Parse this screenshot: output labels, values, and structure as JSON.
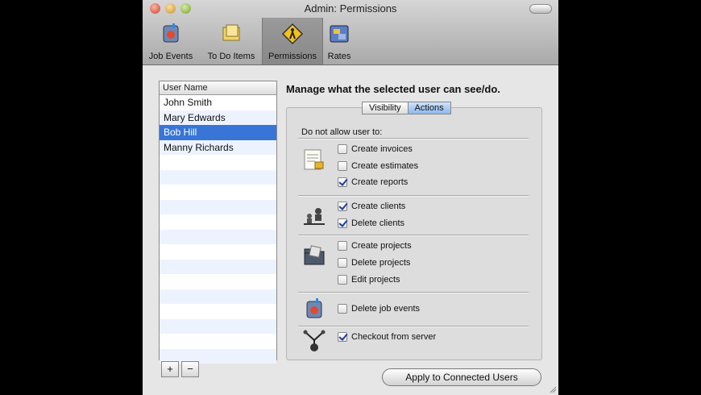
{
  "window": {
    "title": "Admin: Permissions"
  },
  "toolbar": {
    "items": [
      {
        "label": "Job Events",
        "icon": "job-events-icon"
      },
      {
        "label": "To Do Items",
        "icon": "todo-icon"
      },
      {
        "label": "Permissions",
        "icon": "permissions-icon",
        "selected": true
      },
      {
        "label": "Rates",
        "icon": "rates-icon"
      }
    ]
  },
  "users": {
    "header": "User Name",
    "rows": [
      "John Smith",
      "Mary Edwards",
      "Bob Hill",
      "Manny Richards"
    ],
    "selected_index": 2,
    "add_label": "+",
    "remove_label": "−"
  },
  "panel": {
    "heading": "Manage what the selected user can see/do.",
    "tabs": [
      {
        "label": "Visibility"
      },
      {
        "label": "Actions",
        "active": true
      }
    ],
    "group_title": "Do not allow user to:",
    "groups": [
      {
        "icon": "invoice-icon",
        "items": [
          {
            "label": "Create invoices",
            "checked": false
          },
          {
            "label": "Create estimates",
            "checked": false
          },
          {
            "label": "Create reports",
            "checked": true
          }
        ]
      },
      {
        "icon": "clients-icon",
        "items": [
          {
            "label": "Create clients",
            "checked": true
          },
          {
            "label": "Delete clients",
            "checked": true
          }
        ]
      },
      {
        "icon": "projects-icon",
        "items": [
          {
            "label": "Create projects",
            "checked": false
          },
          {
            "label": "Delete projects",
            "checked": false
          },
          {
            "label": "Edit projects",
            "checked": false
          }
        ]
      },
      {
        "icon": "job-event-icon",
        "items": [
          {
            "label": "Delete job events",
            "checked": false
          }
        ]
      },
      {
        "icon": "server-icon",
        "items": [
          {
            "label": "Checkout from server",
            "checked": true
          }
        ]
      }
    ],
    "apply_label": "Apply to Connected Users"
  },
  "colors": {
    "selection": "#3875d7",
    "alt_row": "#edf3fe",
    "active_tab": "#8cb8ee",
    "check": "#1b3f9e"
  }
}
